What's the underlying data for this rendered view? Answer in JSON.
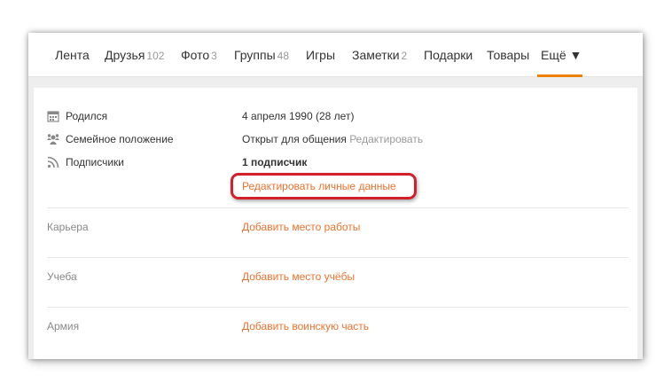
{
  "nav": {
    "items": [
      {
        "label": "Лента",
        "count": ""
      },
      {
        "label": "Друзья",
        "count": "102"
      },
      {
        "label": "Фото",
        "count": "3"
      },
      {
        "label": "Группы",
        "count": "48"
      },
      {
        "label": "Игры",
        "count": ""
      },
      {
        "label": "Заметки",
        "count": "2"
      },
      {
        "label": "Подарки",
        "count": ""
      },
      {
        "label": "Товары",
        "count": ""
      }
    ],
    "more_label": "Ещё ▼",
    "accent_color": "#ee8208"
  },
  "profile": {
    "birth": {
      "label": "Родился",
      "value": "4 апреля 1990 (28 лет)"
    },
    "family": {
      "label": "Семейное положение",
      "value": "Открыт для общения",
      "edit": "Редактировать"
    },
    "subscribers": {
      "label": "Подписчики",
      "value": "1 подписчик"
    },
    "edit_personal": "Редактировать личные данные"
  },
  "sections": {
    "career": {
      "label": "Карьера",
      "action": "Добавить место работы"
    },
    "education": {
      "label": "Учеба",
      "action": "Добавить место учёбы"
    },
    "army": {
      "label": "Армия",
      "action": "Добавить воинскую часть"
    }
  },
  "colors": {
    "link": "#eb722e",
    "highlight": "#d21f2a"
  },
  "icons": {
    "birth": "calendar-icon",
    "family": "family-icon",
    "subscribers": "rss-icon"
  }
}
